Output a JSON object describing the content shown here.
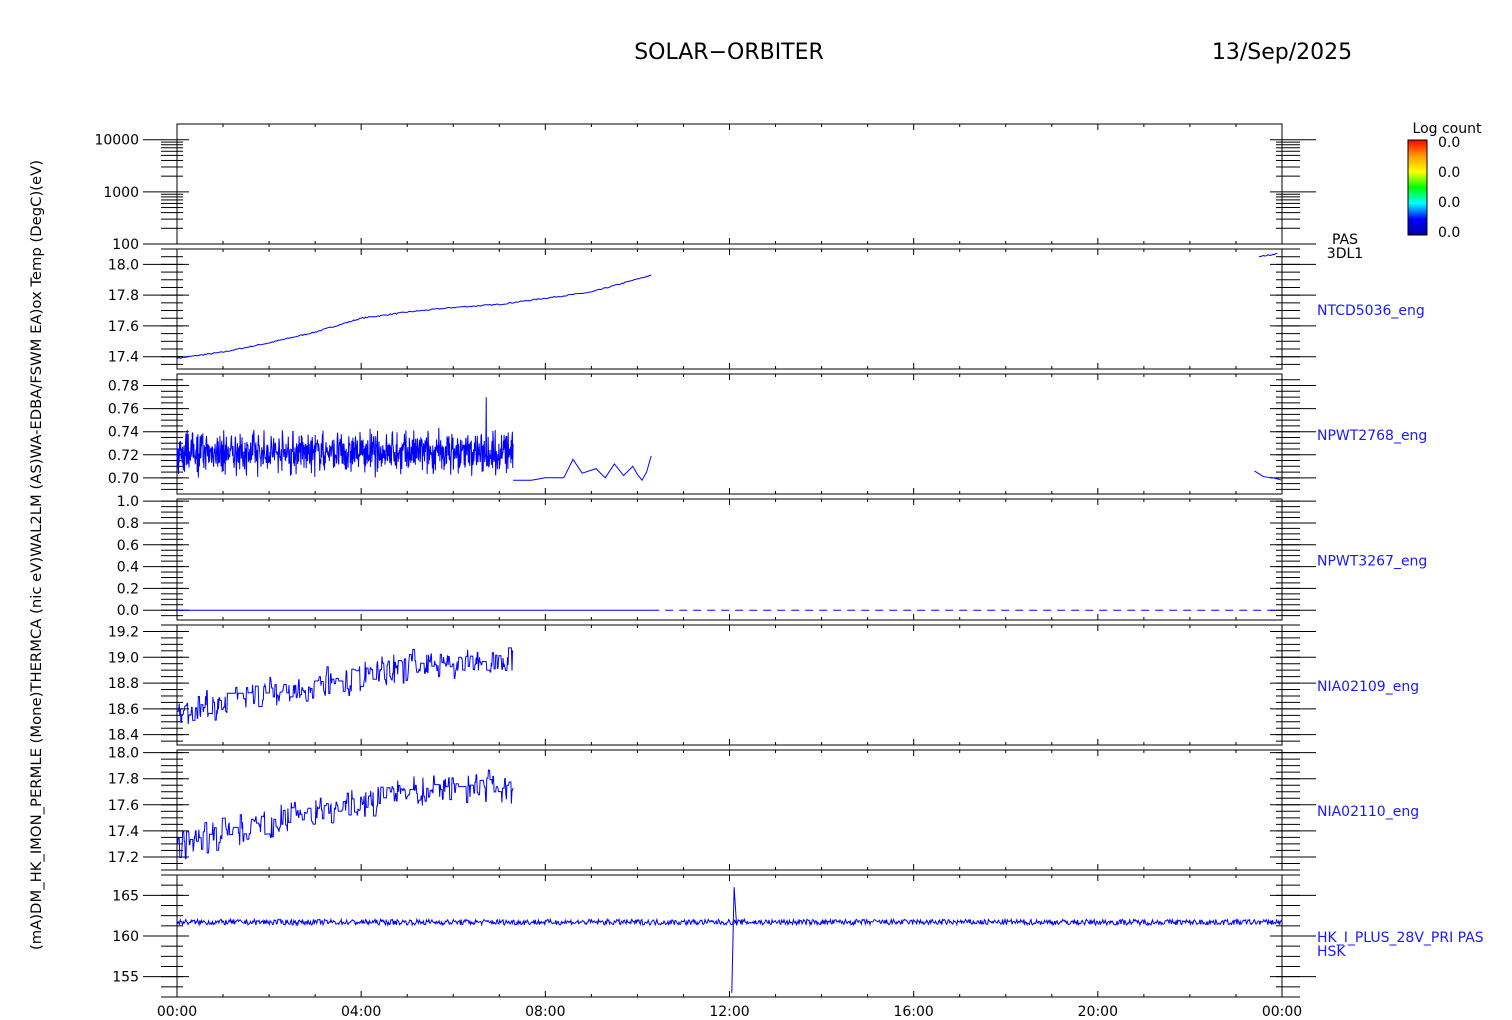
{
  "header": {
    "mission": "SOLAR−ORBITER",
    "date": "13/Sep/2025"
  },
  "colorbar": {
    "title": "Log count",
    "labels": [
      "0.0",
      "0.0",
      "0.0",
      "0.0"
    ],
    "colors": [
      "#ff0000",
      "#ff9900",
      "#ffff00",
      "#00ff00",
      "#00ffff",
      "#0000ff",
      "#0000aa"
    ]
  },
  "left_axis_title_overlapped": "(mA)DM_HK_IMON_PERMLE (Mone)THERMCA (nic eV)WAL2LM (AS)WA-EDBA/FSWM EA)ox Temp (DegC)(eV)",
  "chart_data": {
    "type": "line",
    "x_axis": {
      "ticks": [
        "00:00",
        "04:00",
        "08:00",
        "12:00",
        "16:00",
        "20:00",
        "00:00"
      ],
      "range_hours": [
        0,
        24
      ]
    },
    "line_color": "#0000ff",
    "panels": [
      {
        "id": "pas-3dl1",
        "label": [
          "PAS",
          "3DL1"
        ],
        "label_color": "#000000",
        "scale": "log",
        "ylim": [
          100,
          20000
        ],
        "yticks": [
          {
            "v": 10000,
            "t": "10000"
          },
          {
            "v": 1000,
            "t": "1000"
          },
          {
            "v": 100,
            "t": "100"
          }
        ],
        "series": []
      },
      {
        "id": "ntcd5036",
        "label": [
          "NTCD5036_eng"
        ],
        "ylim": [
          17.32,
          18.1
        ],
        "yticks": [
          {
            "v": 18.0,
            "t": "18.0"
          },
          {
            "v": 17.8,
            "t": "17.8"
          },
          {
            "v": 17.6,
            "t": "17.6"
          },
          {
            "v": 17.4,
            "t": "17.4"
          }
        ],
        "series": [
          {
            "style": "trend",
            "noise": 0.004,
            "points": [
              [
                0,
                17.39
              ],
              [
                1,
                17.43
              ],
              [
                2,
                17.49
              ],
              [
                3,
                17.56
              ],
              [
                4,
                17.65
              ],
              [
                5,
                17.69
              ],
              [
                6,
                17.72
              ],
              [
                7,
                17.74
              ],
              [
                8,
                17.78
              ],
              [
                9,
                17.82
              ],
              [
                10.3,
                17.93
              ]
            ]
          },
          {
            "style": "trend",
            "noise": 0.004,
            "points": [
              [
                23.5,
                18.05
              ],
              [
                23.9,
                18.07
              ]
            ]
          }
        ]
      },
      {
        "id": "npwt2768",
        "label": [
          "NPWT2768_eng"
        ],
        "ylim": [
          0.686,
          0.79
        ],
        "yticks": [
          {
            "v": 0.78,
            "t": "0.78"
          },
          {
            "v": 0.76,
            "t": "0.76"
          },
          {
            "v": 0.74,
            "t": "0.74"
          },
          {
            "v": 0.72,
            "t": "0.72"
          },
          {
            "v": 0.7,
            "t": "0.70"
          }
        ],
        "series": [
          {
            "style": "noise",
            "x0": 0,
            "x1": 7.3,
            "center": 0.722,
            "amp": 0.016,
            "spike": 0.77
          },
          {
            "style": "line",
            "points": [
              [
                7.3,
                0.698
              ],
              [
                7.7,
                0.698
              ],
              [
                8.0,
                0.7
              ],
              [
                8.4,
                0.7
              ],
              [
                8.6,
                0.716
              ],
              [
                8.8,
                0.704
              ],
              [
                9.1,
                0.708
              ],
              [
                9.3,
                0.7
              ],
              [
                9.5,
                0.712
              ],
              [
                9.7,
                0.702
              ],
              [
                9.9,
                0.71
              ],
              [
                10.0,
                0.703
              ],
              [
                10.1,
                0.698
              ],
              [
                10.2,
                0.705
              ],
              [
                10.3,
                0.719
              ]
            ]
          },
          {
            "style": "line",
            "points": [
              [
                23.4,
                0.706
              ],
              [
                23.6,
                0.701
              ],
              [
                23.8,
                0.7
              ],
              [
                24.0,
                0.698
              ]
            ]
          }
        ]
      },
      {
        "id": "npwt3267",
        "label": [
          "NPWT3267_eng"
        ],
        "ylim": [
          -0.09,
          1.02
        ],
        "yticks": [
          {
            "v": 1.0,
            "t": "1.0"
          },
          {
            "v": 0.8,
            "t": "0.8"
          },
          {
            "v": 0.6,
            "t": "0.6"
          },
          {
            "v": 0.4,
            "t": "0.4"
          },
          {
            "v": 0.2,
            "t": "0.2"
          },
          {
            "v": 0.0,
            "t": "0.0"
          }
        ],
        "series": [
          {
            "style": "line",
            "points": [
              [
                0,
                0.0
              ],
              [
                10.3,
                0.0
              ]
            ]
          },
          {
            "style": "dashed",
            "points": [
              [
                10.3,
                0.0
              ],
              [
                24,
                0.0
              ]
            ]
          }
        ]
      },
      {
        "id": "nia02109",
        "label": [
          "NIA02109_eng"
        ],
        "ylim": [
          18.32,
          19.25
        ],
        "yticks": [
          {
            "v": 19.2,
            "t": "19.2"
          },
          {
            "v": 19.0,
            "t": "19.0"
          },
          {
            "v": 18.8,
            "t": "18.8"
          },
          {
            "v": 18.6,
            "t": "18.6"
          },
          {
            "v": 18.4,
            "t": "18.4"
          }
        ],
        "series": [
          {
            "style": "step-noise",
            "x0": 0,
            "x1": 7.3,
            "start": 18.58,
            "end": 18.95,
            "amp": 0.1
          }
        ]
      },
      {
        "id": "nia02110",
        "label": [
          "NIA02110_eng"
        ],
        "ylim": [
          17.1,
          18.02
        ],
        "yticks": [
          {
            "v": 18.0,
            "t": "18.0"
          },
          {
            "v": 17.8,
            "t": "17.8"
          },
          {
            "v": 17.6,
            "t": "17.6"
          },
          {
            "v": 17.4,
            "t": "17.4"
          },
          {
            "v": 17.2,
            "t": "17.2"
          }
        ],
        "series": [
          {
            "style": "step-noise",
            "x0": 0,
            "x1": 7.3,
            "start": 17.3,
            "end": 17.72,
            "amp": 0.1
          }
        ]
      },
      {
        "id": "hk-i-plus",
        "label": [
          "HK_I_PLUS_28V_PRI PAS",
          "HSK"
        ],
        "ylim": [
          152.5,
          167.5
        ],
        "yticks": [
          {
            "v": 165,
            "t": "165"
          },
          {
            "v": 160,
            "t": "160"
          },
          {
            "v": 155,
            "t": "155"
          }
        ],
        "series": [
          {
            "style": "flat-noise",
            "x0": 0,
            "x1": 24,
            "center": 161.7,
            "amp": 0.35,
            "spike": {
              "x": 12.1,
              "min": 153.0,
              "max": 166.0
            }
          }
        ]
      }
    ]
  }
}
